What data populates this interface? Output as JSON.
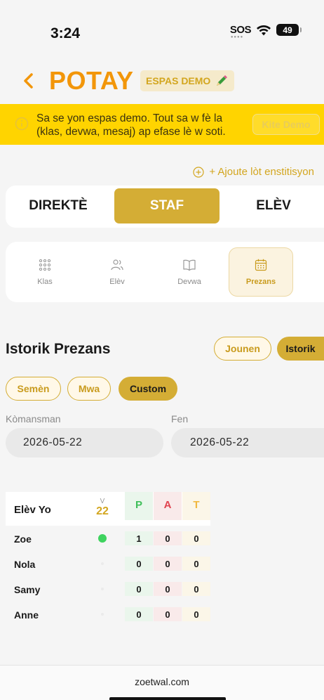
{
  "status_bar": {
    "time": "3:24",
    "sos": "SOS",
    "battery": "49"
  },
  "header": {
    "title": "POTAY",
    "badge": "ESPAS DEMO"
  },
  "banner": {
    "text": "Sa se yon espas demo. Tout sa w fè la (klas, devwa, mesaj) ap efase lè w soti.",
    "button": "Kite Demo"
  },
  "add_institution": "+ Ajoute lòt enstitisyon",
  "role_tabs": [
    "DIREKTÈ",
    "STAF",
    "ELÈV"
  ],
  "active_role": "STAF",
  "modules": [
    {
      "label": "Klas",
      "icon": "grid-icon"
    },
    {
      "label": "Elèv",
      "icon": "users-icon"
    },
    {
      "label": "Devwa",
      "icon": "book-icon"
    },
    {
      "label": "Prezans",
      "icon": "calendar-icon",
      "active": true
    }
  ],
  "attendance": {
    "title": "Istorik Prezans",
    "view_buttons": {
      "today": "Jounen",
      "history": "Istorik"
    },
    "ranges": {
      "week": "Semèn",
      "month": "Mwa",
      "custom": "Custom"
    },
    "start_label": "Kòmansman",
    "end_label": "Fen",
    "start_date": "2026-05-22",
    "end_date": "2026-05-22"
  },
  "table": {
    "header": {
      "name": "Elèv Yo",
      "v_label": "V",
      "v_value": "22",
      "p": "P",
      "a": "A",
      "t": "T"
    },
    "rows": [
      {
        "name": "Zoe",
        "present_dot": true,
        "p": "1",
        "a": "0",
        "t": "0"
      },
      {
        "name": "Nola",
        "present_dot": false,
        "p": "0",
        "a": "0",
        "t": "0"
      },
      {
        "name": "Samy",
        "present_dot": false,
        "p": "0",
        "a": "0",
        "t": "0"
      },
      {
        "name": "Anne",
        "present_dot": false,
        "p": "0",
        "a": "0",
        "t": "0"
      }
    ]
  },
  "footer": {
    "url": "zoetwal.com"
  },
  "colors": {
    "accent": "#d4ad35",
    "title_orange": "#f2960a",
    "banner_yellow": "#ffd400",
    "present_green": "#3fd35f"
  }
}
